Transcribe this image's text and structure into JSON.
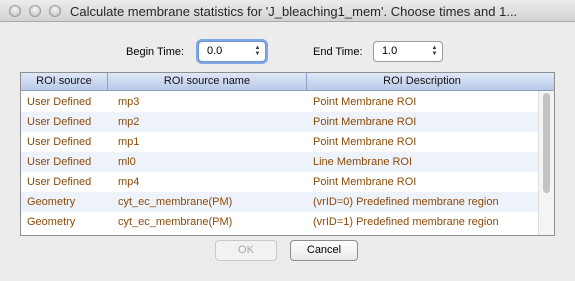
{
  "window": {
    "title": "Calculate membrane statistics for 'J_bleaching1_mem'.  Choose times and 1..."
  },
  "controls": {
    "begin_label": "Begin Time:",
    "begin_value": "0.0",
    "end_label": "End Time:",
    "end_value": "1.0"
  },
  "table": {
    "columns": [
      "ROI source",
      "ROI source name",
      "ROI Description"
    ],
    "rows": [
      [
        "User Defined",
        "mp3",
        "Point Membrane ROI"
      ],
      [
        "User Defined",
        "mp2",
        "Point Membrane ROI"
      ],
      [
        "User Defined",
        "mp1",
        "Point Membrane ROI"
      ],
      [
        "User Defined",
        "ml0",
        "Line Membrane ROI"
      ],
      [
        "User Defined",
        "mp4",
        "Point Membrane ROI"
      ],
      [
        "Geometry",
        "cyt_ec_membrane(PM)",
        "(vrID=0) Predefined membrane region"
      ],
      [
        "Geometry",
        "cyt_ec_membrane(PM)",
        "(vrID=1) Predefined membrane region"
      ]
    ]
  },
  "buttons": {
    "ok": "OK",
    "cancel": "Cancel"
  },
  "colors": {
    "cell_text": "#8a4b08",
    "header_bg": "#b8c9e8",
    "alt_row": "#edf2fb"
  }
}
